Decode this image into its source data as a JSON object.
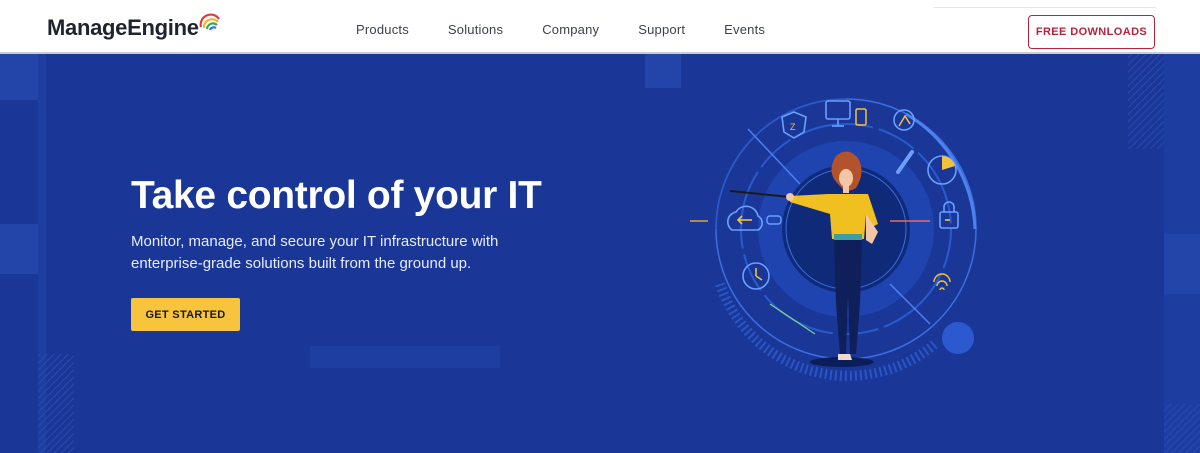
{
  "brand": {
    "name": "ManageEngine"
  },
  "nav": {
    "items": [
      {
        "label": "Products"
      },
      {
        "label": "Solutions"
      },
      {
        "label": "Company"
      },
      {
        "label": "Support"
      },
      {
        "label": "Events"
      }
    ]
  },
  "header": {
    "cta_label": "FREE DOWNLOADS"
  },
  "hero": {
    "title": "Take control of your IT",
    "subtitle": "Monitor, manage, and secure your IT infrastructure with enterprise-grade solutions built from the ground up.",
    "cta_label": "GET STARTED"
  },
  "colors": {
    "hero_background": "#1a3797",
    "accent_yellow": "#f8c43e",
    "brand_red": "#b8233c",
    "nav_text": "#3c4150"
  },
  "icons": [
    "brand-arc-icon",
    "monitor-icon",
    "bulb-icon",
    "shield-icon",
    "clock-icon",
    "cloud-icon",
    "lock-icon",
    "fingerprint-icon",
    "pie-icon",
    "phone-icon",
    "key-icon"
  ]
}
